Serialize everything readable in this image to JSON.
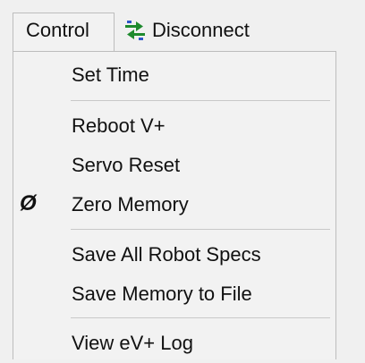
{
  "menubar": {
    "menu_title": "Control",
    "toolbar_button": {
      "label": "Disconnect",
      "icon": "disconnect-arrows-icon"
    }
  },
  "dropdown": {
    "items": [
      {
        "label": "Set Time"
      },
      {
        "label": "Reboot V+"
      },
      {
        "label": "Servo Reset"
      },
      {
        "label": "Zero Memory",
        "glyph": "Ø"
      },
      {
        "label": "Save All Robot Specs"
      },
      {
        "label": "Save Memory to File"
      },
      {
        "label": "View eV+ Log"
      }
    ]
  },
  "colors": {
    "background": "#f0f0f0",
    "menu_background": "#f2f2f2",
    "border": "#bdbdbd",
    "separator": "#c8c8c8",
    "icon_green": "#1e8a2e",
    "icon_blue": "#2e56c8"
  }
}
